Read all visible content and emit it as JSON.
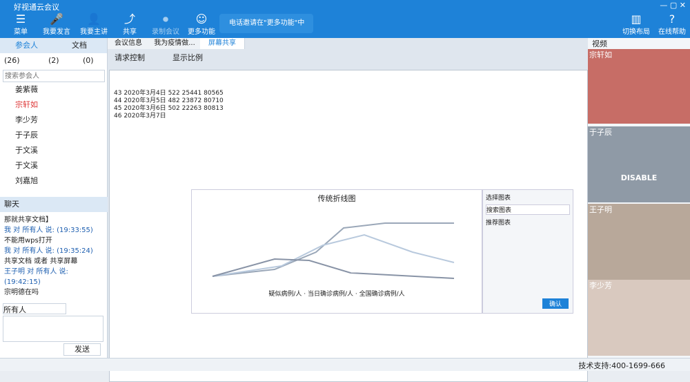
{
  "app": {
    "title": "好视通云会议"
  },
  "toolbar": {
    "menu": "菜单",
    "speak": "我要发言",
    "host": "我要主讲",
    "share": "共享",
    "record": "录制会议",
    "more": "更多功能",
    "tip": "电话邀请在\"更多功能\"中",
    "layout": "切换布局",
    "help": "在线帮助"
  },
  "left": {
    "tab_participants": "参会人",
    "tab_docs": "文档",
    "count_people": "(26)",
    "count_mic": "(2)",
    "count_hand": "(0)",
    "search_placeholder": "搜索参会人",
    "members": [
      "姜紫薇",
      "宗轩如",
      "李少芳",
      "于子辰",
      "于文溪",
      "于文溪",
      "刘嘉旭"
    ],
    "chat_title": "聊天",
    "chat": [
      {
        "t": "那就共享文档】"
      },
      {
        "t": "我 对 所有人 说: (19:33:55)"
      },
      {
        "t": "不能用wps打开"
      },
      {
        "t": "我 对 所有人 说: (19:35:24)"
      },
      {
        "t": "共享文档 或者 共享屏幕"
      },
      {
        "t": "王子明 对 所有人 说: (19:42:15)"
      },
      {
        "t": "宗明德在吗"
      }
    ],
    "to": "所有人",
    "send": "发送"
  },
  "mid": {
    "tabs": [
      "会议信息",
      "我为疫情做...",
      "屏幕共享"
    ],
    "request": "请求控制",
    "ratio": "显示比例"
  },
  "sheet": {
    "rows": [
      {
        "n": "43",
        "d": "2020年3月4日",
        "a": "522",
        "b": "25441",
        "c": "80565"
      },
      {
        "n": "44",
        "d": "2020年3月5日",
        "a": "482",
        "b": "23872",
        "c": "80710"
      },
      {
        "n": "45",
        "d": "2020年3月6日",
        "a": "502",
        "b": "22263",
        "c": "80813"
      },
      {
        "n": "46",
        "d": "2020年3月7日",
        "a": "",
        "b": "",
        "c": ""
      }
    ],
    "chart_title": "传统折线图",
    "legend": [
      "疑似病例/人",
      "当日确诊病例/人",
      "全国确诊病例/人"
    ],
    "side_title": "选择图表",
    "side_search": "搜索图表",
    "side_rec": "推荐图表",
    "ok": "确认"
  },
  "right": {
    "title": "视频",
    "names": [
      "宗轩如",
      "于子辰",
      "王子明",
      "李少芳"
    ],
    "disable": "DISABLE"
  },
  "status": {
    "support": "技术支持:400-1699-666"
  }
}
